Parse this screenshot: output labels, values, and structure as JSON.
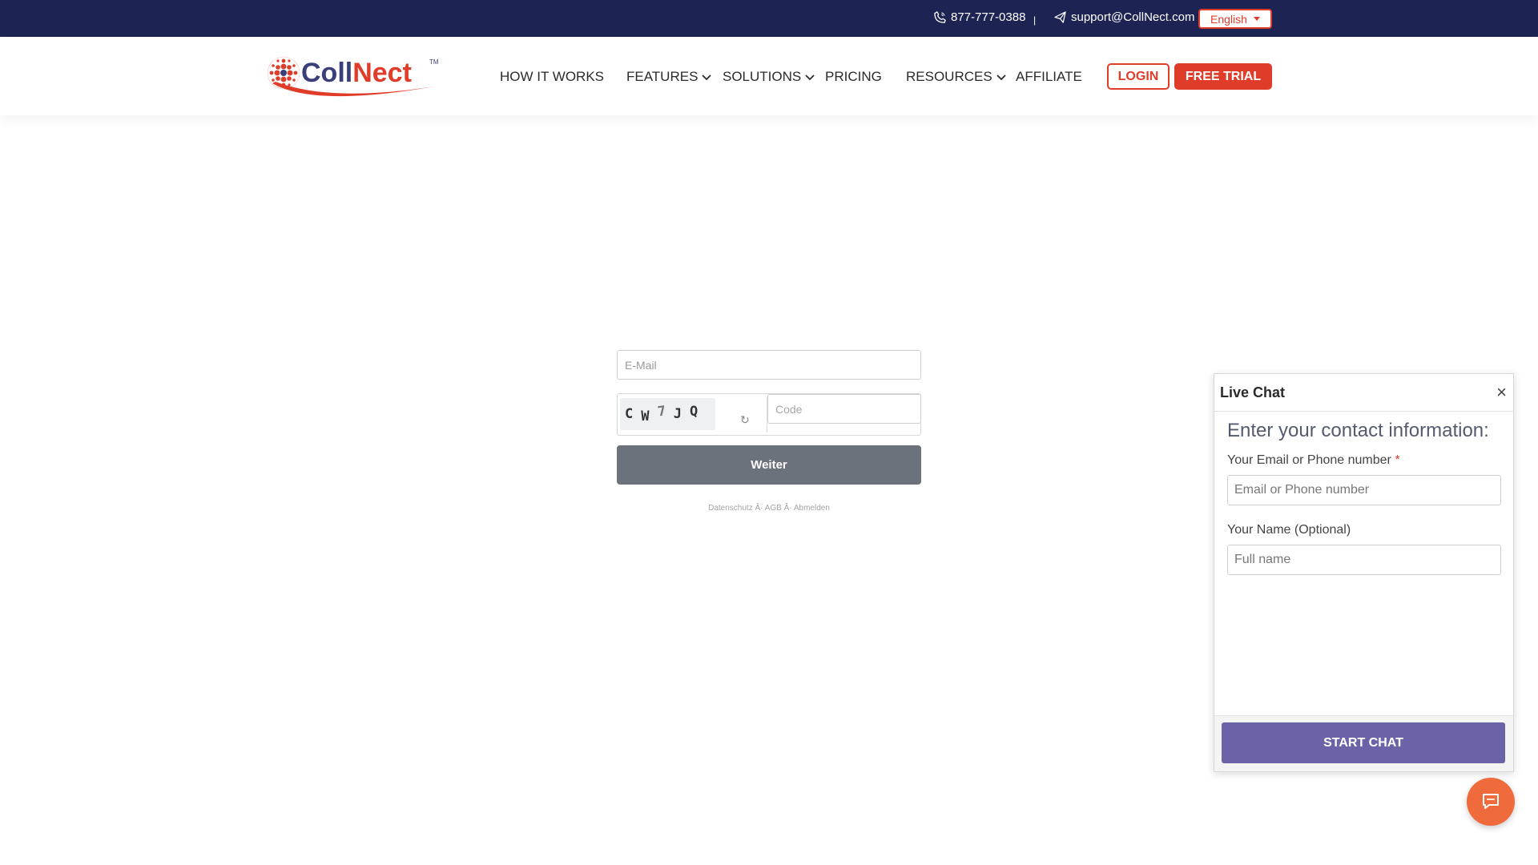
{
  "topbar": {
    "phone": "877-777-0388",
    "separator": "|",
    "email": "support@CollNect.com",
    "language": "English"
  },
  "brand": {
    "name": "CollNect",
    "trademark": "TM",
    "colors": {
      "primary_red": "#e03c2a",
      "navy": "#1d2454",
      "chat_purple": "#6b63a8"
    }
  },
  "nav": {
    "how_it_works": "HOW IT WORKS",
    "features": "FEATURES",
    "solutions": "SOLUTIONS",
    "pricing": "PRICING",
    "resources": "RESOURCES",
    "affiliate": "AFFILIATE",
    "login": "LOGIN",
    "free_trial": "FREE TRIAL"
  },
  "form": {
    "email_placeholder": "E-Mail",
    "captcha_chars": [
      "C",
      "W",
      "7",
      "J",
      "Q"
    ],
    "refresh_symbol": "↻",
    "code_placeholder": "Code",
    "submit_label": "Weiter",
    "footer": {
      "privacy": "Datenschutz",
      "sep": "Â·",
      "terms": "AGB",
      "unsubscribe": "Abmelden"
    }
  },
  "chat": {
    "title": "Live Chat",
    "close": "×",
    "heading": "Enter your contact information:",
    "contact_label": "Your Email or Phone number",
    "required_mark": "*",
    "contact_placeholder": "Email or Phone number",
    "name_label": "Your Name (Optional)",
    "name_placeholder": "Full name",
    "start_label": "START CHAT"
  },
  "icons": {
    "phone": "phone-icon",
    "email": "send-icon",
    "chevron": "chevron-down-icon",
    "fab": "chat-bubble-icon"
  }
}
